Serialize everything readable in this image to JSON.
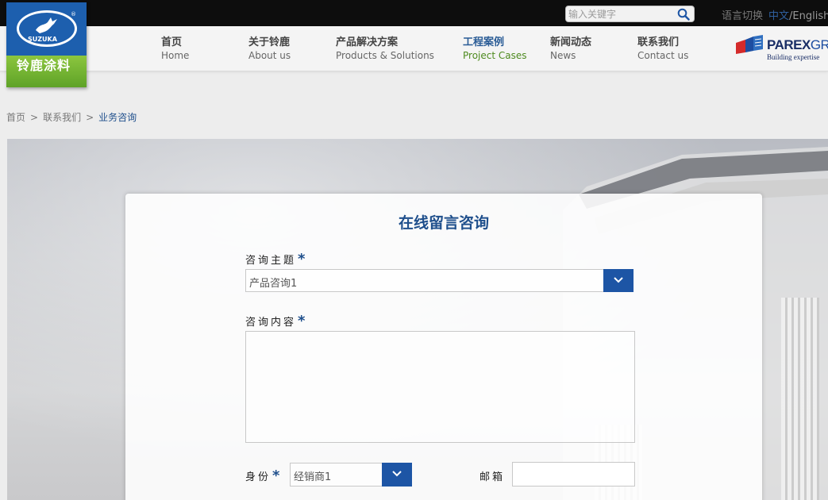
{
  "header": {
    "search_placeholder": "输入关键字",
    "lang_label": "语言切换",
    "lang_zh": "中文",
    "lang_sep": "/",
    "lang_en": "English"
  },
  "logo": {
    "brand_name": "铃鹿涂料",
    "oval_text": "SUZUKA",
    "reg": "®"
  },
  "nav": [
    {
      "zh": "首页",
      "en": "Home"
    },
    {
      "zh": "关于铃鹿",
      "en": "About us"
    },
    {
      "zh": "产品解决方案",
      "en": "Products & Solutions"
    },
    {
      "zh": "工程案例",
      "en": "Project Cases",
      "active": true
    },
    {
      "zh": "新闻动态",
      "en": "News"
    },
    {
      "zh": "联系我们",
      "en": "Contact us"
    }
  ],
  "partner": {
    "name_bold": "PAREX",
    "name_light": "GROUP",
    "tagline": "Building expertise"
  },
  "breadcrumb": {
    "items": [
      "首页",
      "联系我们",
      "业务咨询"
    ],
    "separator": ">"
  },
  "form": {
    "title": "在线留言咨询",
    "topic_label": "咨询主题",
    "topic_value": "产品咨询1",
    "content_label": "咨询内容",
    "identity_label": "身份",
    "identity_value": "经销商1",
    "email_label": "邮箱",
    "required_mark": "*"
  },
  "colors": {
    "accent_blue": "#1f4f8c",
    "button_blue": "#1d55a5",
    "active_en_green": "#4d8a1e",
    "topbar": "#0d0d0d"
  },
  "icons": {
    "search": "search-icon",
    "dropdown": "chevron-down-icon"
  }
}
